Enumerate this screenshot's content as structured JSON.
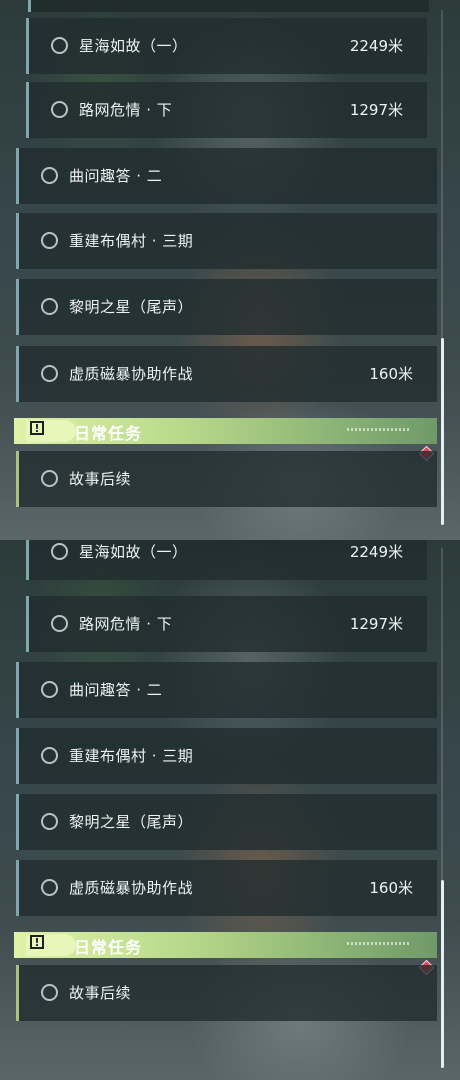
{
  "quests": [
    {
      "title": "星海如故（一）",
      "distance": "2249米",
      "indent": true
    },
    {
      "title": "路网危情 · 下",
      "distance": "1297米",
      "indent": true
    },
    {
      "title": "曲问趣答 · 二",
      "distance": "",
      "indent": false
    },
    {
      "title": "重建布偶村 · 三期",
      "distance": "",
      "indent": false
    },
    {
      "title": "黎明之星（尾声）",
      "distance": "",
      "indent": false
    },
    {
      "title": "虚质磁暴协助作战",
      "distance": "160米",
      "indent": false
    }
  ],
  "daily_section": {
    "title": "日常任务",
    "icon_glyph": "!",
    "items": [
      {
        "title": "故事后续"
      }
    ]
  },
  "colors": {
    "accent_green": "#b8d98a",
    "border_teal": "#7ea8ad",
    "alert_red": "#e0455a"
  },
  "icons": {
    "status": "circle-icon",
    "alert": "diamond-icon",
    "section": "exclamation-icon"
  }
}
